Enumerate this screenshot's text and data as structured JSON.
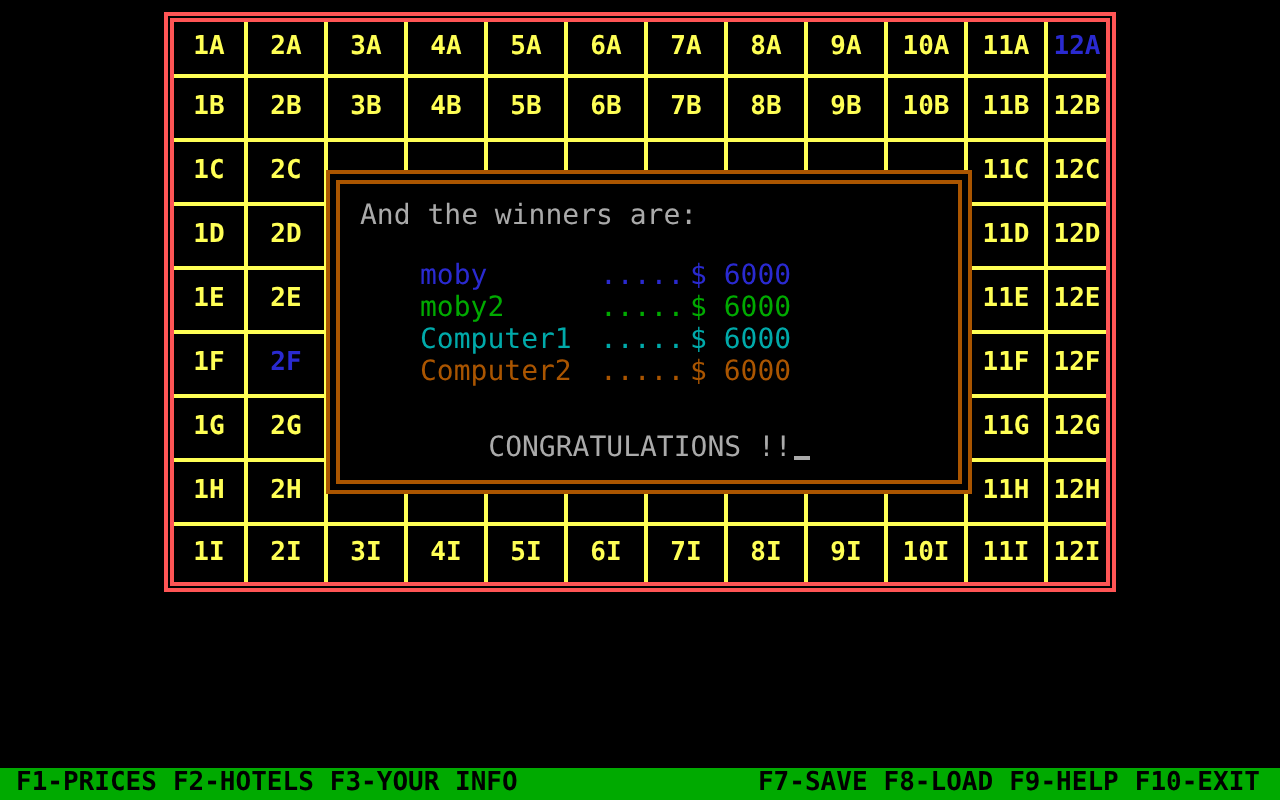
{
  "board": {
    "rows": [
      [
        {
          "label": "1A",
          "color": "#ffff55"
        },
        {
          "label": "2A",
          "color": "#ffff55"
        },
        {
          "label": "3A",
          "color": "#ffff55"
        },
        {
          "label": "4A",
          "color": "#ffff55"
        },
        {
          "label": "5A",
          "color": "#ffff55"
        },
        {
          "label": "6A",
          "color": "#ffff55"
        },
        {
          "label": "7A",
          "color": "#ffff55"
        },
        {
          "label": "8A",
          "color": "#ffff55"
        },
        {
          "label": "9A",
          "color": "#ffff55"
        },
        {
          "label": "10A",
          "color": "#ffff55"
        },
        {
          "label": "11A",
          "color": "#ffff55"
        },
        {
          "label": "12A",
          "color": "#2a2ad0"
        }
      ],
      [
        {
          "label": "1B",
          "color": "#ffff55"
        },
        {
          "label": "2B",
          "color": "#ffff55"
        },
        {
          "label": "3B",
          "color": "#ffff55"
        },
        {
          "label": "4B",
          "color": "#ffff55"
        },
        {
          "label": "5B",
          "color": "#ffff55"
        },
        {
          "label": "6B",
          "color": "#ffff55"
        },
        {
          "label": "7B",
          "color": "#ffff55"
        },
        {
          "label": "8B",
          "color": "#ffff55"
        },
        {
          "label": "9B",
          "color": "#ffff55"
        },
        {
          "label": "10B",
          "color": "#ffff55"
        },
        {
          "label": "11B",
          "color": "#ffff55"
        },
        {
          "label": "12B",
          "color": "#ffff55"
        }
      ],
      [
        {
          "label": "1C",
          "color": "#ffff55"
        },
        {
          "label": "2C",
          "color": "#ffff55"
        },
        null,
        null,
        null,
        null,
        null,
        null,
        null,
        null,
        {
          "label": "11C",
          "color": "#ffff55"
        },
        {
          "label": "12C",
          "color": "#ffff55"
        }
      ],
      [
        {
          "label": "1D",
          "color": "#ffff55"
        },
        {
          "label": "2D",
          "color": "#ffff55"
        },
        null,
        null,
        null,
        null,
        null,
        null,
        null,
        null,
        {
          "label": "11D",
          "color": "#ffff55"
        },
        {
          "label": "12D",
          "color": "#ffff55"
        }
      ],
      [
        {
          "label": "1E",
          "color": "#ffff55"
        },
        {
          "label": "2E",
          "color": "#ffff55"
        },
        null,
        null,
        null,
        null,
        null,
        null,
        null,
        null,
        {
          "label": "11E",
          "color": "#ffff55"
        },
        {
          "label": "12E",
          "color": "#ffff55"
        }
      ],
      [
        {
          "label": "1F",
          "color": "#ffff55"
        },
        {
          "label": "2F",
          "color": "#2a2ad0"
        },
        null,
        null,
        null,
        null,
        null,
        null,
        null,
        null,
        {
          "label": "11F",
          "color": "#ffff55"
        },
        {
          "label": "12F",
          "color": "#ffff55"
        }
      ],
      [
        {
          "label": "1G",
          "color": "#ffff55"
        },
        {
          "label": "2G",
          "color": "#ffff55"
        },
        null,
        null,
        null,
        null,
        null,
        null,
        null,
        null,
        {
          "label": "11G",
          "color": "#ffff55"
        },
        {
          "label": "12G",
          "color": "#ffff55"
        }
      ],
      [
        {
          "label": "1H",
          "color": "#ffff55"
        },
        {
          "label": "2H",
          "color": "#ffff55"
        },
        null,
        null,
        null,
        null,
        null,
        null,
        null,
        null,
        {
          "label": "11H",
          "color": "#ffff55"
        },
        {
          "label": "12H",
          "color": "#ffff55"
        }
      ],
      [
        {
          "label": "1I",
          "color": "#ffff55"
        },
        {
          "label": "2I",
          "color": "#ffff55"
        },
        {
          "label": "3I",
          "color": "#ffff55"
        },
        {
          "label": "4I",
          "color": "#ffff55"
        },
        {
          "label": "5I",
          "color": "#ffff55"
        },
        {
          "label": "6I",
          "color": "#ffff55"
        },
        {
          "label": "7I",
          "color": "#ffff55"
        },
        {
          "label": "8I",
          "color": "#ffff55"
        },
        {
          "label": "9I",
          "color": "#ffff55"
        },
        {
          "label": "10I",
          "color": "#ffff55"
        },
        {
          "label": "11I",
          "color": "#ffff55"
        },
        {
          "label": "12I",
          "color": "#ffff55"
        }
      ]
    ]
  },
  "dialog": {
    "heading": "And the winners are:",
    "winners": [
      {
        "name": "moby",
        "dots": ".....",
        "amount": "$ 6000",
        "color": "#2a2ad0"
      },
      {
        "name": "moby2",
        "dots": ".....",
        "amount": "$ 6000",
        "color": "#00aa00"
      },
      {
        "name": "Computer1",
        "dots": ".....",
        "amount": "$ 6000",
        "color": "#00aaaa"
      },
      {
        "name": "Computer2",
        "dots": ".....",
        "amount": "$ 6000",
        "color": "#aa5500"
      }
    ],
    "message": "CONGRATULATIONS !!",
    "cursor": true
  },
  "function_bar": {
    "left": [
      "F1-PRICES",
      "F2-HOTELS",
      "F3-YOUR INFO"
    ],
    "right": [
      "F7-SAVE",
      "F8-LOAD",
      "F9-HELP",
      "F10-EXIT"
    ]
  }
}
